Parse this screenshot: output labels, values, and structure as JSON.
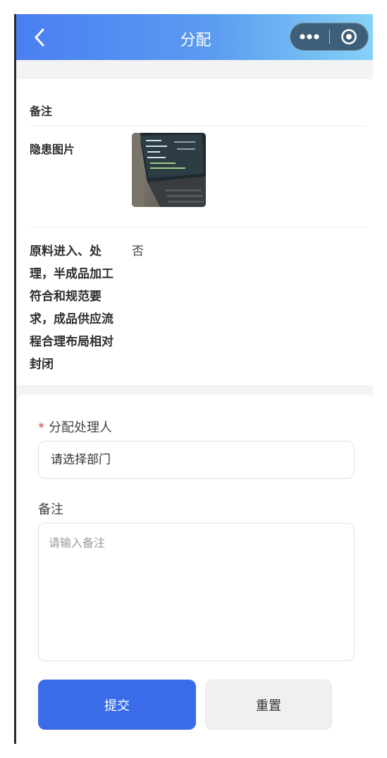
{
  "header": {
    "title": "分配"
  },
  "info": {
    "note_label": "备注",
    "photo_label": "隐患图片",
    "check_item_label": "原料进入、处理，半成品加工符合和规范要求，成品供应流程合理布局相对封闭",
    "check_item_value": "否"
  },
  "form": {
    "assignee_label": "分配处理人",
    "required_mark": "*",
    "assignee_placeholder": "请选择部门",
    "note_label": "备注",
    "note_placeholder": "请输入备注",
    "submit_label": "提交",
    "reset_label": "重置"
  },
  "colors": {
    "primary": "#3a6ce9",
    "required": "#e64545"
  }
}
